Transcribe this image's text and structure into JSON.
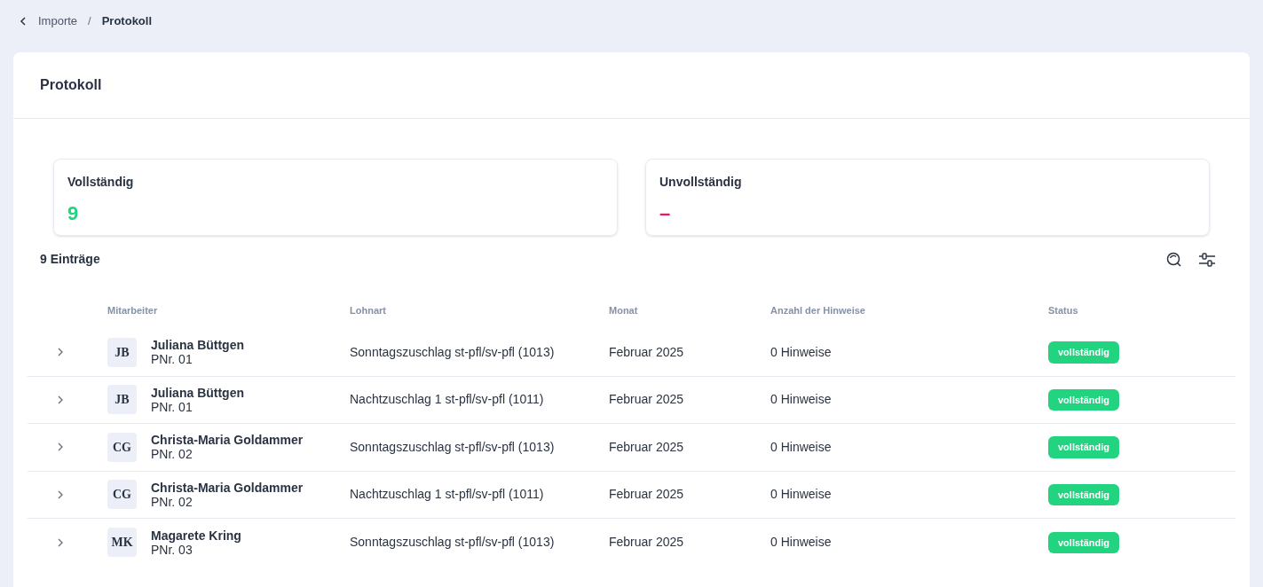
{
  "breadcrumb": {
    "parent": "Importe",
    "separator": "/",
    "current": "Protokoll"
  },
  "title": "Protokoll",
  "stats": [
    {
      "label": "Vollständig",
      "value": "9",
      "color": "#22d37f"
    },
    {
      "label": "Unvollständig",
      "value": "–",
      "color": "#f2145f"
    }
  ],
  "count": "9 Einträge",
  "table": {
    "columns": [
      "Mitarbeiter",
      "Lohnart",
      "Monat",
      "Anzahl der Hinweise",
      "Status"
    ],
    "rows": [
      {
        "initials": "JB",
        "name": "Juliana Büttgen",
        "pnr": "PNr. 01",
        "lohnart": "Sonntagszuschlag st-pfl/sv-pfl (1013)",
        "monat": "Februar 2025",
        "hinweise": "0 Hinweise",
        "status": "vollständig",
        "kind": "complete"
      },
      {
        "initials": "JB",
        "name": "Juliana Büttgen",
        "pnr": "PNr. 01",
        "lohnart": "Nachtzuschlag 1 st-pfl/sv-pfl (1011)",
        "monat": "Februar 2025",
        "hinweise": "0 Hinweise",
        "status": "vollständig",
        "kind": "complete"
      },
      {
        "initials": "CG",
        "name": "Christa-Maria Goldammer",
        "pnr": "PNr. 02",
        "lohnart": "Sonntagszuschlag st-pfl/sv-pfl (1013)",
        "monat": "Februar 2025",
        "hinweise": "0 Hinweise",
        "status": "vollständig",
        "kind": "complete"
      },
      {
        "initials": "CG",
        "name": "Christa-Maria Goldammer",
        "pnr": "PNr. 02",
        "lohnart": "Nachtzuschlag 1 st-pfl/sv-pfl (1011)",
        "monat": "Februar 2025",
        "hinweise": "0 Hinweise",
        "status": "vollständig",
        "kind": "complete"
      },
      {
        "initials": "MK",
        "name": "Magarete Kring",
        "pnr": "PNr. 03",
        "lohnart": "Sonntagszuschlag st-pfl/sv-pfl (1013)",
        "monat": "Februar 2025",
        "hinweise": "0 Hinweise",
        "status": "vollständig",
        "kind": "complete"
      }
    ]
  }
}
